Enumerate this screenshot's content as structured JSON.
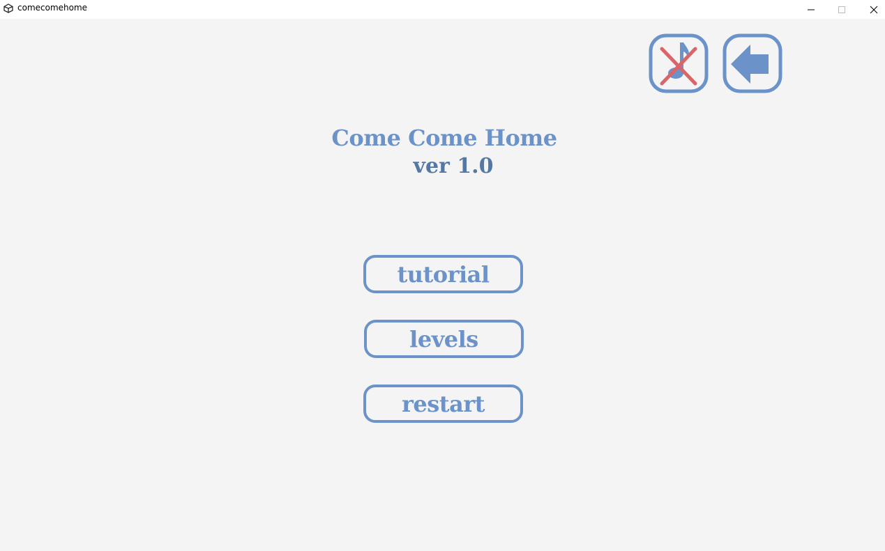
{
  "window": {
    "title": "comecomehome"
  },
  "game": {
    "title": "Come Come Home",
    "version": "ver 1.0",
    "menu": {
      "tutorial": "tutorial",
      "levels": "levels",
      "restart": "restart"
    },
    "icons": {
      "sound": "sound-muted-icon",
      "back": "back-arrow-icon"
    },
    "colors": {
      "accent": "#6b93c9",
      "accent_dark": "#5577a3",
      "mute_cross": "#d9646a",
      "background": "#f4f4f4"
    }
  }
}
